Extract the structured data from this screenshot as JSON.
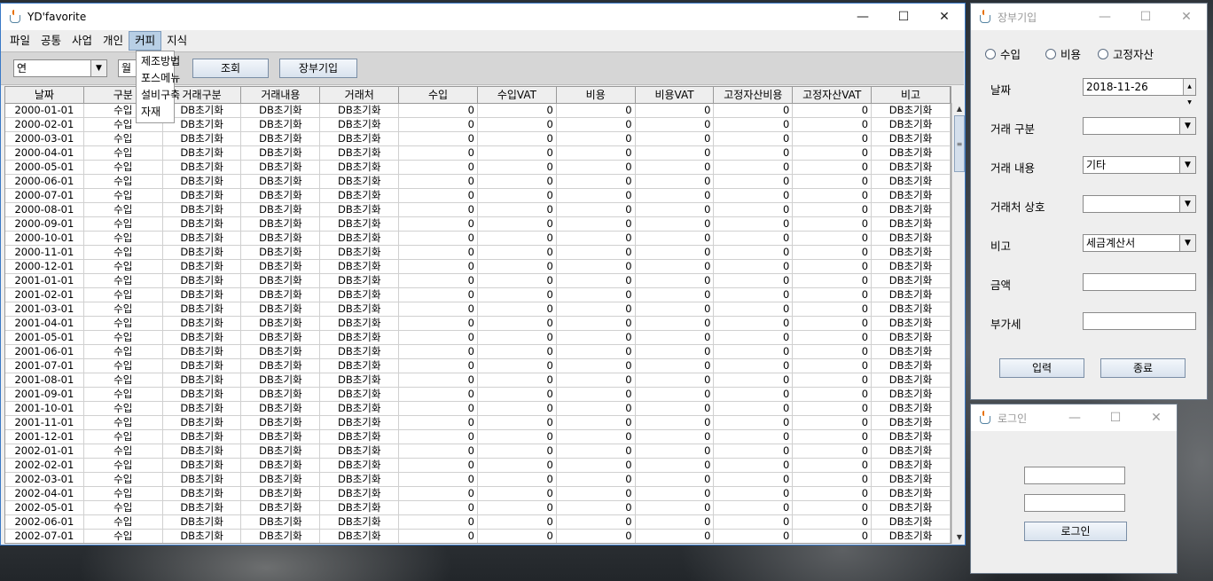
{
  "main_window": {
    "title": "YD'favorite",
    "menus": [
      "파일",
      "공통",
      "사업",
      "개인",
      "커피",
      "지식"
    ],
    "active_menu": "커피",
    "dropdown_items": [
      "제조방법",
      "포스메뉴",
      "설비구축",
      "자재"
    ],
    "toolbar": {
      "year_combo": "연",
      "month_combo": "월",
      "query_button": "조회",
      "ledger_button": "장부기입"
    },
    "columns": [
      "날짜",
      "구분",
      "거래구분",
      "거래내용",
      "거래처",
      "수입",
      "수입VAT",
      "비용",
      "비용VAT",
      "고정자산비용",
      "고정자산VAT",
      "비고"
    ],
    "row_template": {
      "type": "수입",
      "trade_type": "DB초기화",
      "content": "DB초기화",
      "vendor": "DB초기화",
      "income": "0",
      "income_vat": "0",
      "cost": "0",
      "cost_vat": "0",
      "asset_cost": "0",
      "asset_vat": "0",
      "note": "DB초기화"
    },
    "dates": [
      "2000-01-01",
      "2000-02-01",
      "2000-03-01",
      "2000-04-01",
      "2000-05-01",
      "2000-06-01",
      "2000-07-01",
      "2000-08-01",
      "2000-09-01",
      "2000-10-01",
      "2000-11-01",
      "2000-12-01",
      "2001-01-01",
      "2001-02-01",
      "2001-03-01",
      "2001-04-01",
      "2001-05-01",
      "2001-06-01",
      "2001-07-01",
      "2001-08-01",
      "2001-09-01",
      "2001-10-01",
      "2001-11-01",
      "2001-12-01",
      "2002-01-01",
      "2002-02-01",
      "2002-03-01",
      "2002-04-01",
      "2002-05-01",
      "2002-06-01",
      "2002-07-01"
    ]
  },
  "ledger_window": {
    "title": "장부기입",
    "radios": [
      "수입",
      "비용",
      "고정자산"
    ],
    "labels": {
      "date": "날짜",
      "trade_type": "거래 구분",
      "content": "거래 내용",
      "vendor": "거래처 상호",
      "note": "비고",
      "amount": "금액",
      "vat": "부가세"
    },
    "values": {
      "date": "2018-11-26",
      "trade_type": "",
      "content": "기타",
      "vendor": "",
      "note": "세금계산서",
      "amount": "",
      "vat": ""
    },
    "buttons": {
      "submit": "입력",
      "close": "종료"
    }
  },
  "login_window": {
    "title": "로그인",
    "button": "로그인"
  }
}
